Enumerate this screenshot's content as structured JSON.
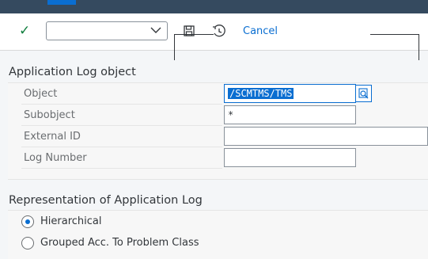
{
  "toolbar": {
    "execute_icon": "checkmark-icon",
    "variant_value": "",
    "save_icon": "save-icon",
    "history_icon": "history-icon",
    "cancel_label": "Cancel"
  },
  "app_log_object": {
    "title": "Application Log object",
    "fields": [
      {
        "label": "Object",
        "value": "/SCMTMS/TMS"
      },
      {
        "label": "Subobject",
        "value": "*"
      },
      {
        "label": "External ID",
        "value": ""
      },
      {
        "label": "Log Number",
        "value": ""
      }
    ]
  },
  "representation": {
    "title": "Representation of Application Log",
    "options": [
      {
        "label": "Hierarchical",
        "selected": true
      },
      {
        "label": "Grouped Acc. To Problem Class",
        "selected": false
      }
    ]
  },
  "colors": {
    "shell": "#354a5f",
    "accent": "#0a6ed1",
    "success": "#107e3e"
  }
}
